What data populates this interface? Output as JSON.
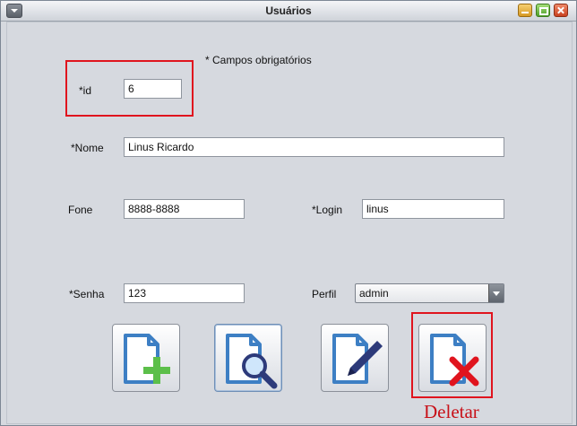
{
  "window": {
    "title": "Usuários"
  },
  "form": {
    "required_note": "* Campos obrigatórios",
    "id_label": "*id",
    "id_value": "6",
    "nome_label": "*Nome",
    "nome_value": "Linus Ricardo",
    "fone_label": "Fone",
    "fone_value": "8888-8888",
    "login_label": "*Login",
    "login_value": "linus",
    "senha_label": "*Senha",
    "senha_value": "123",
    "perfil_label": "Perfil",
    "perfil_value": "admin"
  },
  "toolbar": {
    "buttons": [
      {
        "action": "create",
        "icon": "document-add-icon"
      },
      {
        "action": "read",
        "icon": "document-search-icon"
      },
      {
        "action": "update",
        "icon": "document-edit-icon"
      },
      {
        "action": "delete",
        "icon": "document-delete-icon"
      }
    ]
  },
  "annotation": {
    "delete_label": "Deletar",
    "highlight_color": "#e0141e"
  },
  "colors": {
    "document_blue": "#3d7fc4",
    "add_green": "#5cbf4a",
    "delete_red": "#e0141e",
    "pen_navy": "#2d3a7a"
  }
}
